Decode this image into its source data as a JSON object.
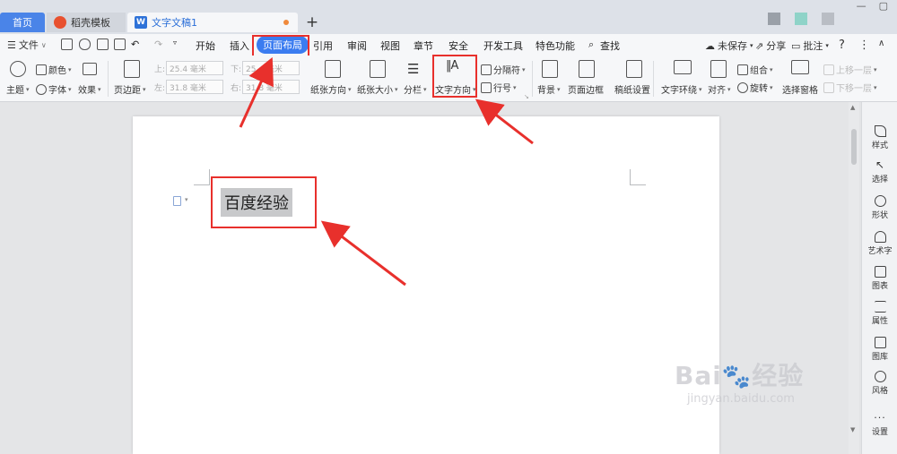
{
  "tabs": {
    "home": "首页",
    "templates": "稻壳模板",
    "document": "文字文稿1",
    "new_tab": "+"
  },
  "menu": {
    "file": "文件",
    "items": [
      "开始",
      "插入",
      "页面布局",
      "引用",
      "审阅",
      "视图",
      "章节",
      "安全",
      "开发工具",
      "特色功能",
      "查找"
    ],
    "active": "页面布局",
    "unsaved": "未保存",
    "share": "分享",
    "comment": "批注",
    "help": "?"
  },
  "ribbon": {
    "theme": "主题",
    "color": "颜色",
    "font": "字体",
    "effect": "效果",
    "margin": "页边距",
    "top_label": "上:",
    "bottom_label": "下:",
    "left_label": "左:",
    "right_label": "右:",
    "top_val": "25.4 毫米",
    "bottom_val": "25.4 毫米",
    "left_val": "31.8 毫米",
    "right_val": "31.8 毫米",
    "orientation": "纸张方向",
    "paper_size": "纸张大小",
    "columns": "分栏",
    "text_direction": "文字方向",
    "separator": "分隔符",
    "line_number": "行号",
    "background": "背景",
    "page_border": "页面边框",
    "draft_paper": "稿纸设置",
    "text_wrap": "文字环绕",
    "align": "对齐",
    "group": "组合",
    "rotate": "旋转",
    "selection_pane": "选择窗格",
    "bring_forward": "上移一层",
    "send_backward": "下移一层"
  },
  "document": {
    "text": "百度经验"
  },
  "right_panel": [
    "样式",
    "选择",
    "形状",
    "艺术字",
    "图表",
    "属性",
    "图库",
    "风格",
    "设置"
  ],
  "watermark": {
    "main": "Bai",
    "main2": "经验",
    "sub": "jingyan.baidu.com"
  },
  "colors": {
    "accent": "#3b7cf0",
    "annotation": "#e8302c",
    "home_tab": "#4a84e8"
  }
}
